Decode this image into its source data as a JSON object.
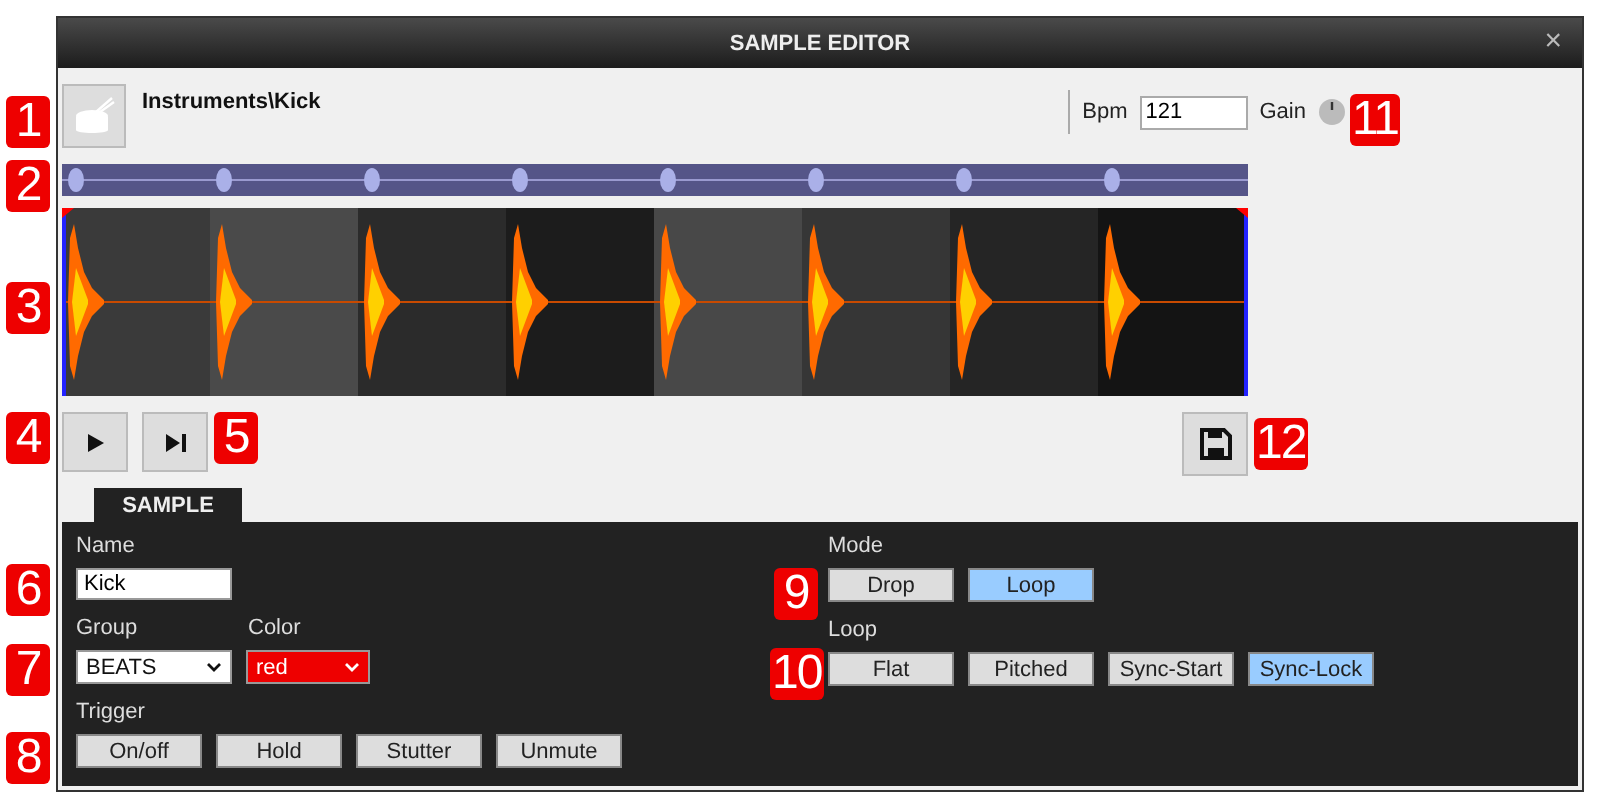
{
  "window": {
    "title": "SAMPLE EDITOR",
    "close": "×"
  },
  "header": {
    "path": "Instruments\\Kick",
    "bpm_label": "Bpm",
    "bpm_value": "121",
    "gain_label": "Gain"
  },
  "tabs": [
    {
      "label": "SAMPLE",
      "selected": true
    }
  ],
  "sample": {
    "name_label": "Name",
    "name_value": "Kick",
    "group_label": "Group",
    "group_value": "BEATS",
    "color_label": "Color",
    "color_value": "red",
    "trigger_label": "Trigger",
    "trigger_buttons": [
      "On/off",
      "Hold",
      "Stutter",
      "Unmute"
    ],
    "mode_label": "Mode",
    "mode_buttons": [
      {
        "label": "Drop",
        "selected": false
      },
      {
        "label": "Loop",
        "selected": true
      }
    ],
    "loop_label": "Loop",
    "loop_buttons": [
      {
        "label": "Flat",
        "selected": false
      },
      {
        "label": "Pitched",
        "selected": false
      },
      {
        "label": "Sync-Start",
        "selected": false
      },
      {
        "label": "Sync-Lock",
        "selected": true
      }
    ]
  },
  "callouts": [
    "1",
    "2",
    "3",
    "4",
    "5",
    "6",
    "7",
    "8",
    "9",
    "10",
    "11",
    "12"
  ]
}
